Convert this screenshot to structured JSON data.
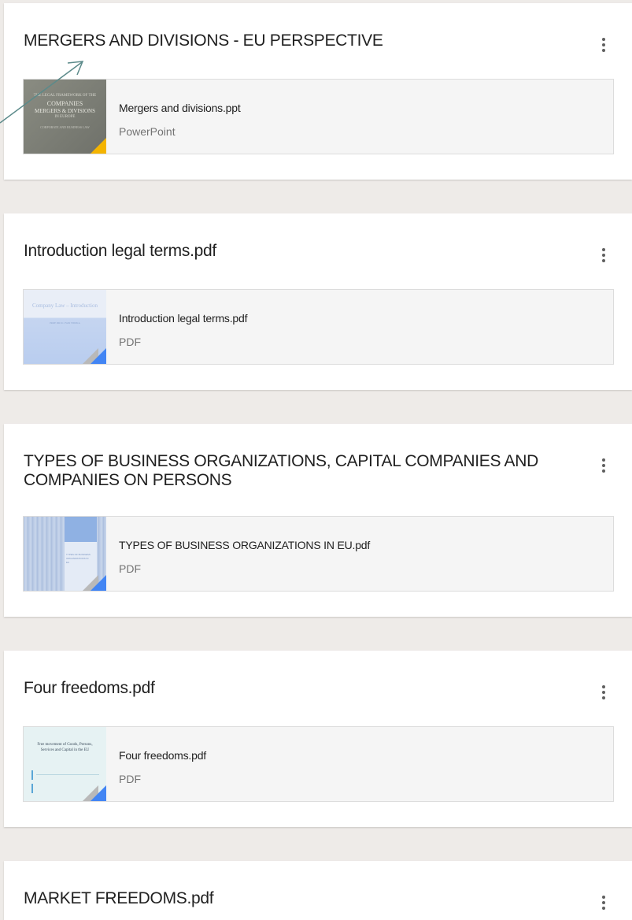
{
  "colors": {
    "background": "#eeebe8",
    "card": "#ffffff",
    "title_text": "#212121",
    "type_text": "#737373",
    "ppt_corner": "#f4b400",
    "pdf_corner": "#4285f4"
  },
  "cards": [
    {
      "title": "MERGERS AND DIVISIONS - EU PERSPECTIVE",
      "attachment": {
        "name": "Mergers and divisions.ppt",
        "type": "PowerPoint",
        "thumb_lines": [
          "THE LEGAL FRAMEWORK OF THE",
          "COMPANIES",
          "MERGERS & DIVISIONS",
          "IN EUROPE",
          "CORPORATE AND BUSINESS LAW"
        ]
      }
    },
    {
      "title": "Introduction legal terms.pdf",
      "attachment": {
        "name": "Introduction legal terms.pdf",
        "type": "PDF",
        "thumb_lines": [
          "Company Law – Introduction",
          "PROF. DR.SC. IVAN VIDUKA"
        ]
      }
    },
    {
      "title": "TYPES OF BUSINESS ORGANIZATIONS, CAPITAL COMPANIES AND COMPANIES ON PERSONS",
      "attachment": {
        "name": "TYPES OF BUSINESS ORGANIZATIONS IN EU.pdf",
        "type": "PDF",
        "thumb_lines": [
          "TYPES OF BUSINESS",
          "ORGANIZATIONS IN",
          "EU"
        ]
      }
    },
    {
      "title": "Four freedoms.pdf",
      "attachment": {
        "name": "Four freedoms.pdf",
        "type": "PDF",
        "thumb_lines": [
          "Free movement of Goods, Persons,",
          "Services and Capital in the EU"
        ]
      }
    },
    {
      "title": "MARKET FREEDOMS.pdf"
    }
  ]
}
